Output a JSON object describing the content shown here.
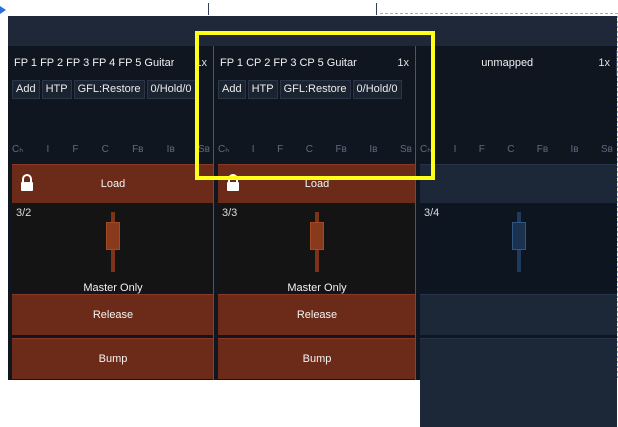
{
  "faders": [
    {
      "name": "FP 1 FP 2 FP 3 FP 4 FP 5  Guitar",
      "speed": "1x",
      "modes": [
        "Add",
        "HTP",
        "GFL:Restore",
        "0/Hold/0"
      ],
      "caps": [
        "Cₕ",
        "I",
        "F",
        "C",
        "Fʙ",
        "Iʙ",
        "Sʙ"
      ],
      "load_label": "Load",
      "index": "3/2",
      "master_label": "Master Only",
      "release_label": "Release",
      "bump_label": "Bump"
    },
    {
      "name": "FP 1 CP 2 FP 3 CP 5  Guitar",
      "speed": "1x",
      "modes": [
        "Add",
        "HTP",
        "GFL:Restore",
        "0/Hold/0"
      ],
      "caps": [
        "Cₕ",
        "I",
        "F",
        "C",
        "Fʙ",
        "Iʙ",
        "Sʙ"
      ],
      "load_label": "Load",
      "index": "3/3",
      "master_label": "Master Only",
      "release_label": "Release",
      "bump_label": "Bump"
    },
    {
      "name": "unmapped",
      "speed": "1x",
      "caps": [
        "Cₕ",
        "I",
        "F",
        "C",
        "Fʙ",
        "Iʙ",
        "Sʙ"
      ],
      "index": "3/4"
    }
  ],
  "colors": {
    "active_button": "#6c2a18",
    "fader_bg": "#0f1620",
    "highlight": "#ffff1a"
  }
}
